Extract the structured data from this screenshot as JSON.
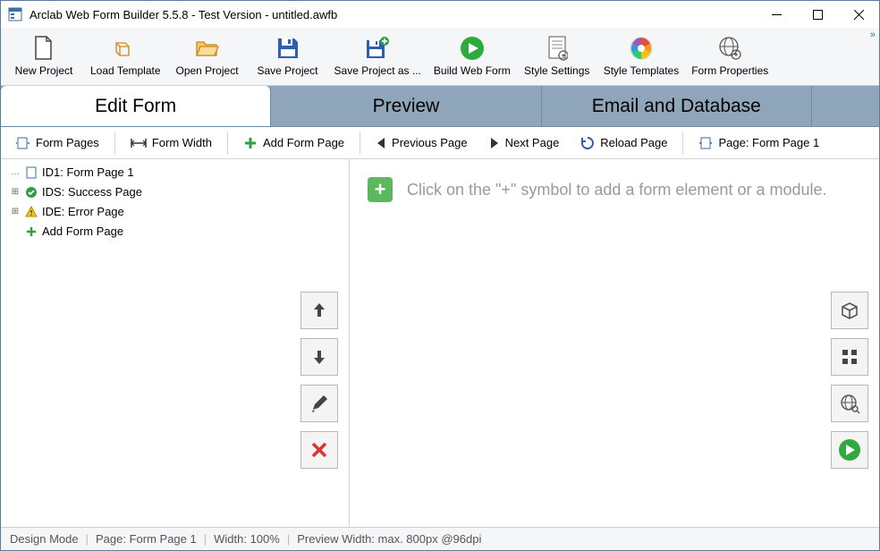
{
  "title": "Arclab Web Form Builder 5.5.8 - Test Version - untitled.awfb",
  "toolbar": [
    {
      "label": "New Project",
      "icon": "new"
    },
    {
      "label": "Load Template",
      "icon": "template"
    },
    {
      "label": "Open Project",
      "icon": "open"
    },
    {
      "label": "Save Project",
      "icon": "save"
    },
    {
      "label": "Save Project as ...",
      "icon": "saveas"
    },
    {
      "label": "Build Web Form",
      "icon": "build"
    },
    {
      "label": "Style Settings",
      "icon": "styleset"
    },
    {
      "label": "Style Templates",
      "icon": "styletpl"
    },
    {
      "label": "Form Properties",
      "icon": "props"
    }
  ],
  "tabs": [
    {
      "label": "Edit Form",
      "active": true
    },
    {
      "label": "Preview",
      "active": false
    },
    {
      "label": "Email and Database",
      "active": false
    }
  ],
  "subbar": {
    "form_pages": "Form Pages",
    "form_width": "Form Width",
    "add_page": "Add Form Page",
    "prev_page": "Previous Page",
    "next_page": "Next Page",
    "reload": "Reload Page",
    "page_label": "Page: Form Page 1"
  },
  "tree": [
    {
      "expander": "",
      "icon": "page",
      "label": "ID1: Form Page 1"
    },
    {
      "expander": "+",
      "icon": "success",
      "label": "IDS: Success Page"
    },
    {
      "expander": "+",
      "icon": "error",
      "label": "IDE: Error Page"
    },
    {
      "expander": "",
      "icon": "add",
      "label": "Add Form Page"
    }
  ],
  "canvas_hint": "Click on the \"+\" symbol to add a form element or a module.",
  "status": {
    "mode": "Design Mode",
    "page": "Page: Form Page 1",
    "width": "Width: 100%",
    "preview": "Preview Width: max. 800px @96dpi"
  }
}
